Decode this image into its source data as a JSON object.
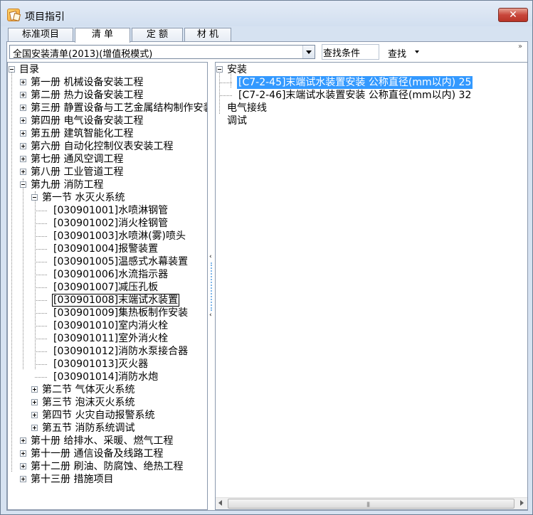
{
  "window": {
    "title": "项目指引",
    "close_label": "✕"
  },
  "tabs": [
    {
      "label": "标准项目",
      "active": false
    },
    {
      "label": "清  单",
      "active": true
    },
    {
      "label": "定  额",
      "active": false
    },
    {
      "label": "材  机",
      "active": false
    }
  ],
  "toolbar": {
    "list_select_value": "全国安装清单(2013)(增值税模式)",
    "condition_label": "查找条件",
    "find_label": "查找",
    "more_label": "»"
  },
  "left_tree": [
    {
      "text": "目录",
      "level": 0,
      "expander": "minus"
    },
    {
      "text": "第一册   机械设备安装工程",
      "level": 1,
      "expander": "plus"
    },
    {
      "text": "第二册   热力设备安装工程",
      "level": 1,
      "expander": "plus"
    },
    {
      "text": "第三册   静置设备与工艺金属结构制作安装工程",
      "level": 1,
      "expander": "plus"
    },
    {
      "text": "第四册   电气设备安装工程",
      "level": 1,
      "expander": "plus"
    },
    {
      "text": "第五册   建筑智能化工程",
      "level": 1,
      "expander": "plus"
    },
    {
      "text": "第六册   自动化控制仪表安装工程",
      "level": 1,
      "expander": "plus"
    },
    {
      "text": "第七册   通风空调工程",
      "level": 1,
      "expander": "plus"
    },
    {
      "text": "第八册   工业管道工程",
      "level": 1,
      "expander": "plus"
    },
    {
      "text": "第九册   消防工程",
      "level": 1,
      "expander": "minus"
    },
    {
      "text": "第一节   水灭火系统",
      "level": 2,
      "expander": "minus"
    },
    {
      "text": "[030901001]水喷淋钢管",
      "level": 3
    },
    {
      "text": "[030901002]消火栓钢管",
      "level": 3
    },
    {
      "text": "[030901003]水喷淋(雾)喷头",
      "level": 3
    },
    {
      "text": "[030901004]报警装置",
      "level": 3
    },
    {
      "text": "[030901005]温感式水幕装置",
      "level": 3
    },
    {
      "text": "[030901006]水流指示器",
      "level": 3
    },
    {
      "text": "[030901007]减压孔板",
      "level": 3
    },
    {
      "text": "[030901008]末端试水装置",
      "level": 3,
      "focused": true
    },
    {
      "text": "[030901009]集热板制作安装",
      "level": 3
    },
    {
      "text": "[030901010]室内消火栓",
      "level": 3
    },
    {
      "text": "[030901011]室外消火栓",
      "level": 3
    },
    {
      "text": "[030901012]消防水泵接合器",
      "level": 3
    },
    {
      "text": "[030901013]灭火器",
      "level": 3
    },
    {
      "text": "[030901014]消防水炮",
      "level": 3
    },
    {
      "text": "第二节   气体灭火系统",
      "level": 2,
      "expander": "plus"
    },
    {
      "text": "第三节   泡沫灭火系统",
      "level": 2,
      "expander": "plus"
    },
    {
      "text": "第四节   火灾自动报警系统",
      "level": 2,
      "expander": "plus"
    },
    {
      "text": "第五节   消防系统调试",
      "level": 2,
      "expander": "plus"
    },
    {
      "text": "第十册   给排水、采暖、燃气工程",
      "level": 1,
      "expander": "plus"
    },
    {
      "text": "第十一册   通信设备及线路工程",
      "level": 1,
      "expander": "plus"
    },
    {
      "text": "第十二册   刷油、防腐蚀、绝热工程",
      "level": 1,
      "expander": "plus"
    },
    {
      "text": "第十三册   措施项目",
      "level": 1,
      "expander": "plus"
    }
  ],
  "right_tree": [
    {
      "text": "安装",
      "level": 0,
      "expander": "minus"
    },
    {
      "text": "[C7-2-45]末端试水装置安装 公称直径(mm以内) 25",
      "level": 1,
      "selected": true
    },
    {
      "text": "[C7-2-46]末端试水装置安装 公称直径(mm以内) 32",
      "level": 1
    },
    {
      "text": "电气接线",
      "level": 0
    },
    {
      "text": "调试",
      "level": 0
    }
  ],
  "splitter": {
    "up": "‹",
    "down": "‹"
  },
  "scrollbar": {
    "grip": "|||"
  },
  "colors": {
    "selection": "#3399ff",
    "window_chrome": "#d6e2f1",
    "close_button": "#c8463b"
  }
}
